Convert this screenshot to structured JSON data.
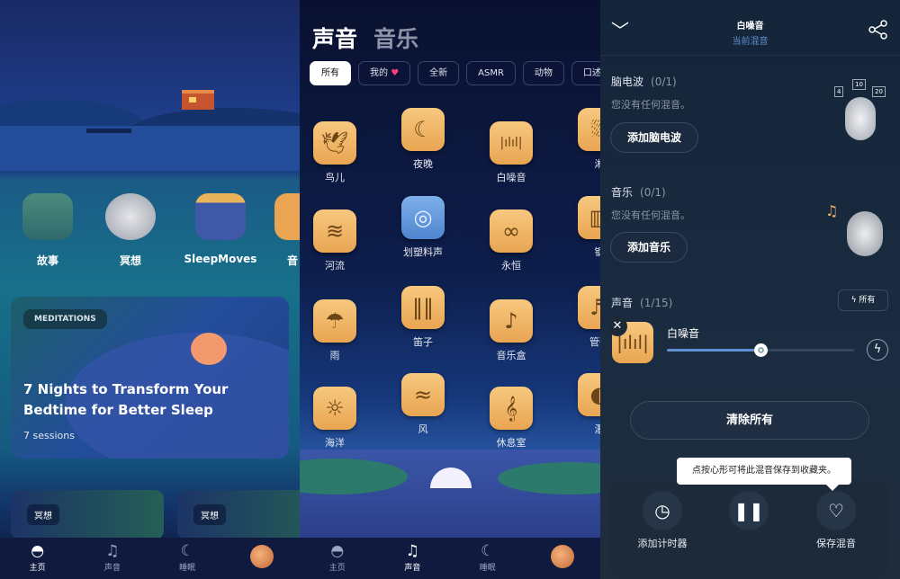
{
  "home": {
    "categories": [
      {
        "label": "故事",
        "icon": "storybook-icon"
      },
      {
        "label": "冥想",
        "icon": "meditating-owl-icon"
      },
      {
        "label": "SleepMoves",
        "icon": "sleepmoves-icon"
      },
      {
        "label": "音",
        "icon": "music-icon"
      }
    ],
    "featured": {
      "badge": "MEDITATIONS",
      "title": "7 Nights to Transform Your Bedtime for Better Sleep",
      "subtitle": "7 sessions"
    },
    "mini_cards": [
      "冥想",
      "冥想"
    ]
  },
  "nav": {
    "items": [
      {
        "label": "主页",
        "icon": "home-icon"
      },
      {
        "label": "声音",
        "icon": "music-note-icon"
      },
      {
        "label": "睡眠",
        "icon": "moon-icon"
      },
      {
        "label": "",
        "icon": "avatar"
      }
    ]
  },
  "sounds": {
    "tabs": [
      "声音",
      "音乐"
    ],
    "chips": [
      "所有",
      "我的",
      "全新",
      "ASMR",
      "动物",
      "口述"
    ],
    "items": [
      {
        "label": "鸟儿",
        "icon": "bird-icon"
      },
      {
        "label": "夜晚",
        "icon": "crescent-moon-icon"
      },
      {
        "label": "白噪音",
        "icon": "waveform-icon"
      },
      {
        "label": "淋",
        "icon": "shower-icon"
      },
      {
        "label": "河流",
        "icon": "waves-icon"
      },
      {
        "label": "划塑料声",
        "icon": "vinyl-icon"
      },
      {
        "label": "永恒",
        "icon": "infinity-icon"
      },
      {
        "label": "钢",
        "icon": "piano-icon"
      },
      {
        "label": "雨",
        "icon": "rain-cloud-icon"
      },
      {
        "label": "笛子",
        "icon": "pan-flute-icon"
      },
      {
        "label": "音乐盒",
        "icon": "music-box-icon"
      },
      {
        "label": "管弦",
        "icon": "harp-icon"
      },
      {
        "label": "海洋",
        "icon": "ocean-sun-icon"
      },
      {
        "label": "风",
        "icon": "wind-icon"
      },
      {
        "label": "休息室",
        "icon": "treble-clef-icon"
      },
      {
        "label": "瀑",
        "icon": "water-drop-icon"
      }
    ]
  },
  "mix": {
    "title": "白噪音",
    "subtitle": "当前混音",
    "brainwave": {
      "label": "脑电波",
      "count": "(0/1)",
      "empty": "您没有任何混音。",
      "button": "添加脑电波",
      "badges": [
        "4",
        "10",
        "20"
      ]
    },
    "music": {
      "label": "音乐",
      "count": "(0/1)",
      "empty": "您没有任何混音。",
      "button": "添加音乐"
    },
    "sounds": {
      "label": "声音",
      "count": "(1/15)",
      "all_button": "所有",
      "track": {
        "name": "白噪音",
        "volume": 0.5
      }
    },
    "clear_button": "清除所有",
    "tooltip": "点按心形可将此混音保存到收藏夹。",
    "timer_label": "添加计时器",
    "save_label": "保存混音",
    "accent": "#5f8fd0"
  }
}
